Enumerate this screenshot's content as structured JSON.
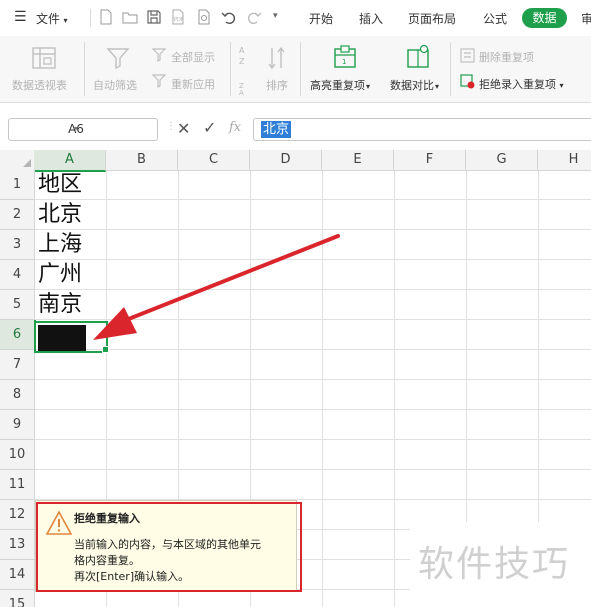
{
  "menubar": {
    "file_label": "文件",
    "tabs": [
      "开始",
      "插入",
      "页面布局",
      "公式",
      "数据",
      "审"
    ]
  },
  "ribbon": {
    "pivot_label": "数据透视表",
    "autofilter_label": "自动筛选",
    "show_all_label": "全部显示",
    "reapply_label": "重新应用",
    "sort_label": "排序",
    "highlight_dup_label": "高亮重复项",
    "compare_label": "数据对比",
    "remove_dup_label": "删除重复项",
    "reject_dup_label": "拒绝录入重复项"
  },
  "formula_bar": {
    "name_box": "A6",
    "fx_label": "fx",
    "value": "北京"
  },
  "sheet": {
    "columns": [
      "A",
      "B",
      "C",
      "D",
      "E",
      "F",
      "G",
      "H"
    ],
    "rows": [
      "1",
      "2",
      "3",
      "4",
      "5",
      "6",
      "7",
      "8",
      "9",
      "10",
      "11",
      "12",
      "13",
      "14",
      "15"
    ],
    "cells_a": [
      "地区",
      "北京",
      "上海",
      "广州",
      "南京",
      "北京"
    ]
  },
  "tooltip": {
    "title": "拒绝重复输入",
    "line1": "当前输入的内容，与本区域的其他单元",
    "line2": "格内容重复。",
    "line3": "再次[Enter]确认输入。"
  },
  "watermark": "软件技巧",
  "colors": {
    "accent": "#1e9f4c",
    "annotation_red": "#d9252b",
    "selection_blue": "#2f7fd8",
    "tooltip_bg": "#fffde6"
  }
}
